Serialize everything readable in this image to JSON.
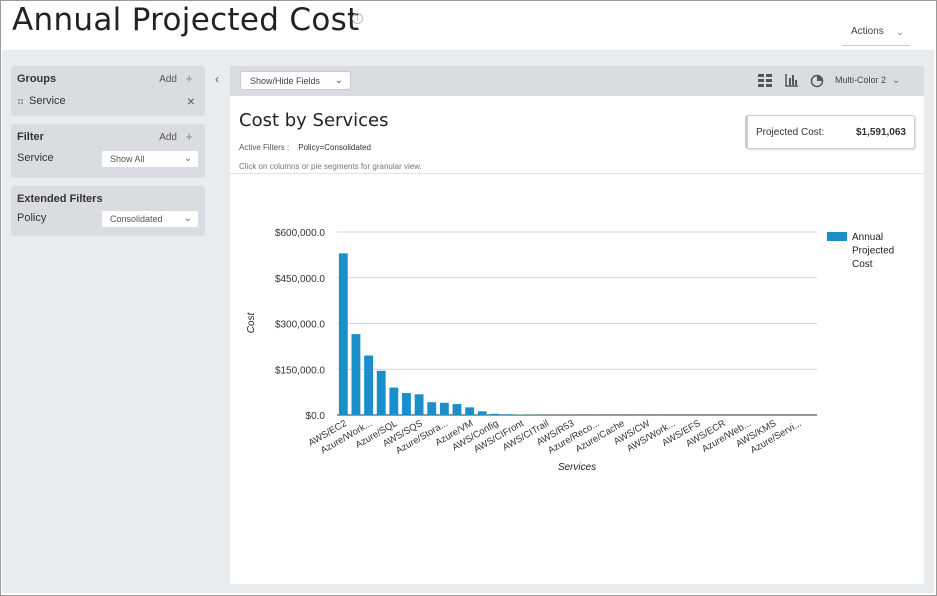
{
  "header": {
    "title": "Annual Projected Cost",
    "info_icon": "info-icon",
    "actions_label": "Actions"
  },
  "sidebar": {
    "groups": {
      "title": "Groups",
      "add_label": "Add",
      "item_label": "Service"
    },
    "filter": {
      "title": "Filter",
      "add_label": "Add",
      "field_label": "Service",
      "field_value": "Show All"
    },
    "extended": {
      "title": "Extended Filters",
      "field_label": "Policy",
      "field_value": "Consolidated"
    }
  },
  "toolbar": {
    "show_hide_label": "Show/Hide Fields",
    "icons": [
      "grid-view-icon",
      "bar-chart-icon",
      "pie-chart-icon"
    ],
    "palette_label": "Multi-Color 2"
  },
  "card": {
    "title": "Cost by Services",
    "active_filters_label": "Active Filters :",
    "active_filters_value": "Policy=Consolidated",
    "hint": "Click on columns or pie segments for granular view.",
    "projected_label": "Projected Cost:",
    "projected_value": "$1,591,063"
  },
  "colors": {
    "bar": "#1a8fc9",
    "panel": "#d9dde1",
    "background": "#e8ecef"
  },
  "chart_data": {
    "type": "bar",
    "xlabel": "Services",
    "ylabel": "Cost",
    "ylim": [
      0,
      600000
    ],
    "yticks": [
      "$0.0",
      "$150,000.0",
      "$300,000.0",
      "$450,000.0",
      "$600,000.0"
    ],
    "legend": "Annual Projected Cost",
    "legend_position": "top-right",
    "grid": true,
    "x_tick_labels": [
      "AWS/EC2",
      "Azure/Work...",
      "Azure/SQL",
      "AWS/SQS",
      "Azure/Stora...",
      "Azure/VM",
      "AWS/Config",
      "AWS/CIFront",
      "AWS/CITrail",
      "AWS/R53",
      "Azure/Reco...",
      "Azure/Cache",
      "AWS/CW",
      "AWS/Work...",
      "AWS/EFS",
      "AWS/ECR",
      "Azure/Web...",
      "AWS/KMS",
      "Azure/Servi..."
    ],
    "values": [
      530000,
      265000,
      195000,
      145000,
      90000,
      72000,
      68000,
      42000,
      40000,
      36000,
      25000,
      12000,
      4000,
      2500,
      1500,
      800,
      500,
      300,
      200,
      150,
      120,
      100,
      80,
      70,
      60,
      50,
      40,
      30,
      25,
      20,
      18,
      16,
      14,
      12,
      10,
      9,
      8,
      7
    ]
  }
}
